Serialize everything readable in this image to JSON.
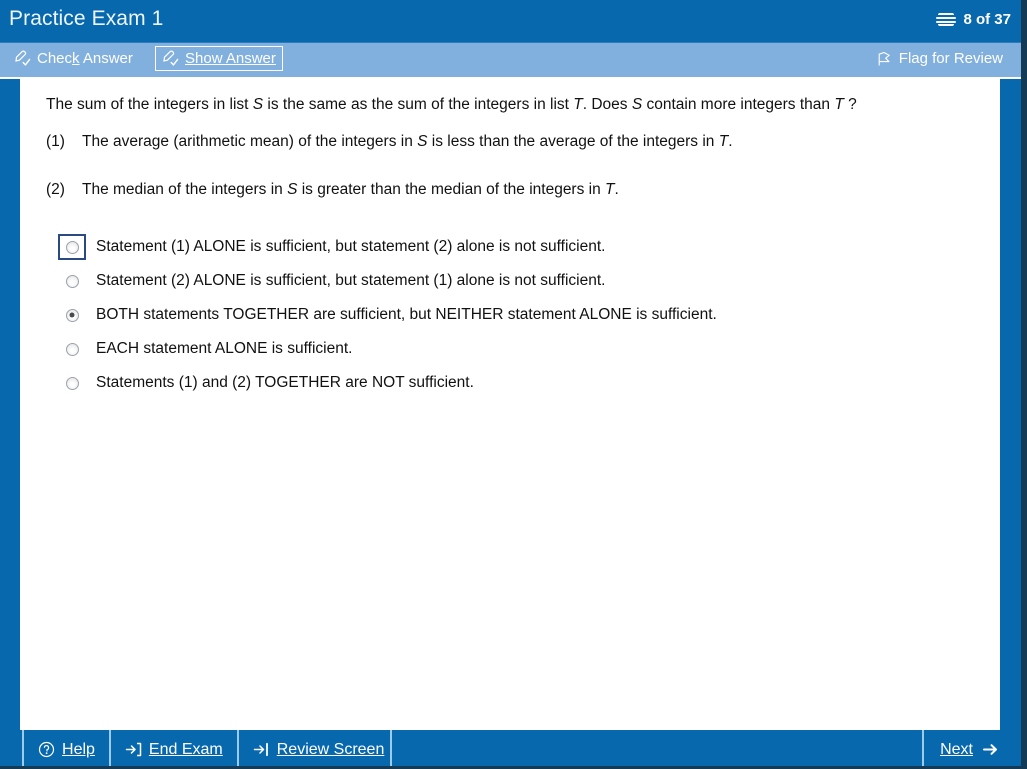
{
  "colors": {
    "title_bar": "#0768ad",
    "toolbar": "#82b0de",
    "content_bg": "#ffffff",
    "footer": "#0768ad",
    "focus_border": "#2b4a80",
    "separator": "#9ccbe9"
  },
  "titlebar": {
    "title": "Practice Exam 1",
    "counter": "8 of 37",
    "counter_icon": "stack-icon"
  },
  "toolbar": {
    "check_answer": {
      "label": "Check Answer",
      "accel": "k",
      "icon": "pencil-check-icon"
    },
    "show_answer": {
      "label": "Show Answer",
      "accel": "o",
      "icon": "pencil-check-icon",
      "focused": true
    },
    "flag_for_review": {
      "label": "Flag for Review",
      "icon": "flag-icon"
    }
  },
  "question": {
    "stem_parts": [
      {
        "t": "The sum of the integers in list ",
        "i": false
      },
      {
        "t": "S",
        "i": true
      },
      {
        "t": " is the same as the sum of the integers in list ",
        "i": false
      },
      {
        "t": "T",
        "i": true
      },
      {
        "t": ". Does ",
        "i": false
      },
      {
        "t": "S",
        "i": true
      },
      {
        "t": " contain more integers than ",
        "i": false
      },
      {
        "t": "T",
        "i": true
      },
      {
        "t": " ?",
        "i": false
      }
    ],
    "statements": [
      {
        "num": "(1)",
        "parts": [
          {
            "t": "The average (arithmetic mean) of the integers in ",
            "i": false
          },
          {
            "t": "S",
            "i": true
          },
          {
            "t": " is less than the average of the integers in ",
            "i": false
          },
          {
            "t": "T",
            "i": true
          },
          {
            "t": ".",
            "i": false
          }
        ]
      },
      {
        "num": "(2)",
        "parts": [
          {
            "t": "The median of the integers in ",
            "i": false
          },
          {
            "t": "S",
            "i": true
          },
          {
            "t": " is greater than the median of the integers in ",
            "i": false
          },
          {
            "t": "T",
            "i": true
          },
          {
            "t": ".",
            "i": false
          }
        ]
      }
    ],
    "options": [
      {
        "label": "Statement (1) ALONE is sufficient, but statement (2) alone is not sufficient.",
        "selected": false,
        "focused": true
      },
      {
        "label": "Statement (2) ALONE is sufficient, but statement (1) alone is not sufficient.",
        "selected": false,
        "focused": false
      },
      {
        "label": "BOTH statements TOGETHER are sufficient, but NEITHER statement ALONE is sufficient.",
        "selected": true,
        "focused": false
      },
      {
        "label": "EACH statement ALONE is sufficient.",
        "selected": false,
        "focused": false
      },
      {
        "label": "Statements (1) and (2) TOGETHER are NOT sufficient.",
        "selected": false,
        "focused": false
      }
    ]
  },
  "footer": {
    "help": {
      "label": "Help",
      "accel": "H",
      "icon": "question-circle-icon"
    },
    "end_exam": {
      "label": "End Exam",
      "accel": "E",
      "icon": "exit-arrow-icon"
    },
    "review_screen": {
      "label": "Review Screen",
      "accel": "S",
      "icon": "arrow-to-bar-icon"
    },
    "next": {
      "label": "Next",
      "accel": "N",
      "icon": "arrow-right-icon"
    }
  }
}
